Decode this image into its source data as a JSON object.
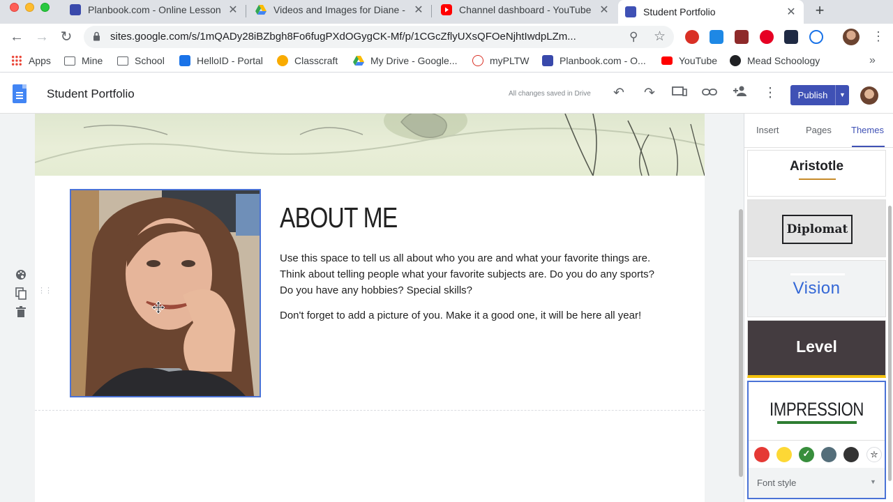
{
  "browser": {
    "tabs": [
      {
        "title": "Planbook.com - Online Lesson",
        "favicon_color": "#3949ab",
        "active": false
      },
      {
        "title": "Videos and Images for Diane -",
        "favicon_color": "#34a853",
        "active": false
      },
      {
        "title": "Channel dashboard - YouTube",
        "favicon_color": "#ea4335",
        "active": false
      },
      {
        "title": "Student Portfolio",
        "favicon_color": "#3f51b5",
        "active": true
      }
    ],
    "new_tab_label": "+",
    "close_label": "✕",
    "url": "sites.google.com/s/1mQADy28iBZbgh8Fo6fugPXdOGygCK-Mf/p/1CGcZflyUXsQFOeNjhtIwdpLZm...",
    "bookmarks": [
      {
        "label": "Apps",
        "icon": "apps-grid-icon",
        "color": "#ea4335"
      },
      {
        "label": "Mine",
        "icon": "folder-icon",
        "color": "#5f6368"
      },
      {
        "label": "School",
        "icon": "folder-icon",
        "color": "#5f6368"
      },
      {
        "label": "HelloID - Portal",
        "icon": "helloid-icon",
        "color": "#1a73e8"
      },
      {
        "label": "Classcraft",
        "icon": "classcraft-icon",
        "color": "#f9ab00"
      },
      {
        "label": "My Drive - Google...",
        "icon": "drive-icon",
        "color": "#34a853"
      },
      {
        "label": "myPLTW",
        "icon": "pltw-icon",
        "color": "#d93025"
      },
      {
        "label": "Planbook.com - O...",
        "icon": "planbook-icon",
        "color": "#3949ab"
      },
      {
        "label": "YouTube",
        "icon": "youtube-icon",
        "color": "#ff0000"
      },
      {
        "label": "Mead Schoology",
        "icon": "schoology-icon",
        "color": "#202124"
      }
    ],
    "bookmarks_more": "»"
  },
  "sites": {
    "title": "Student Portfolio",
    "save_status": "All changes saved in Drive",
    "publish_label": "Publish",
    "accent": "#3f51b5"
  },
  "page": {
    "heading": "ABOUT ME",
    "paragraph1": "Use this space to tell us all about who you are and what your favorite things are. Think about telling people what your favorite subjects are. Do you do any sports? Do you have any hobbies? Special skills?",
    "paragraph2": "Don't forget to add a picture of you. Make it a good one, it will be here all year!"
  },
  "panel": {
    "tabs": [
      "Insert",
      "Pages",
      "Themes"
    ],
    "active_tab": "Themes",
    "themes": [
      "Aristotle",
      "Diplomat",
      "Vision",
      "Level",
      "IMPRESSION"
    ],
    "selected_theme": "IMPRESSION",
    "swatches": [
      "#e53935",
      "#fdd835",
      "#388e3c",
      "#546e7a",
      "#333333"
    ],
    "selected_swatch": 2,
    "font_style_label": "Font style"
  }
}
